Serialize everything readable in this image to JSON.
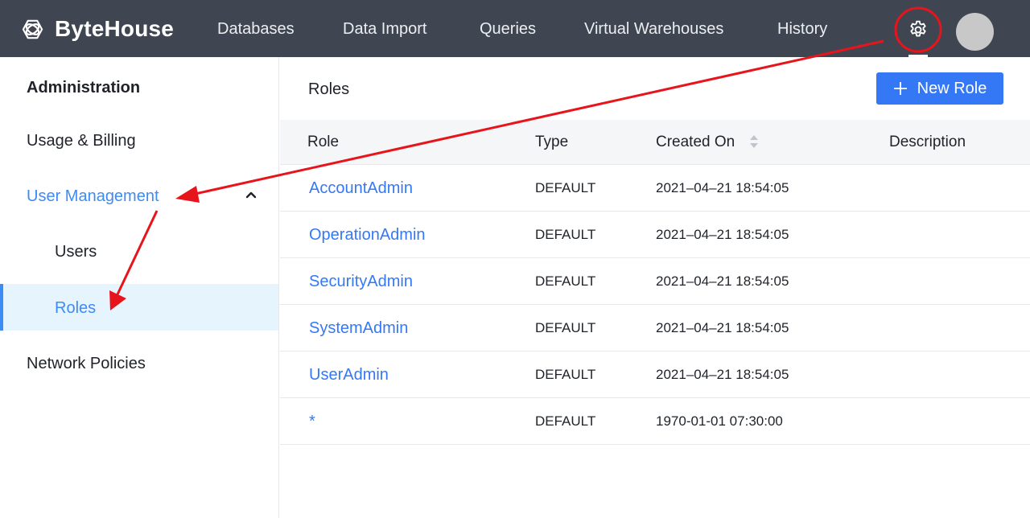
{
  "brand": {
    "name": "ByteHouse"
  },
  "nav": {
    "items": [
      {
        "label": "Databases"
      },
      {
        "label": "Data Import"
      },
      {
        "label": "Queries"
      },
      {
        "label": "Virtual Warehouses"
      },
      {
        "label": "History"
      }
    ]
  },
  "sidebar": {
    "items": [
      {
        "label": "Administration"
      },
      {
        "label": "Usage & Billing"
      },
      {
        "label": "User Management",
        "expanded": true
      },
      {
        "label": "Users"
      },
      {
        "label": "Roles",
        "selected": true
      },
      {
        "label": "Network Policies"
      }
    ]
  },
  "main": {
    "title": "Roles",
    "new_button_label": "New Role",
    "columns": [
      "Role",
      "Type",
      "Created On",
      "Description"
    ],
    "rows": [
      {
        "role": "AccountAdmin",
        "type": "DEFAULT",
        "created": "2021–04–21 18:54:05",
        "description": ""
      },
      {
        "role": "OperationAdmin",
        "type": "DEFAULT",
        "created": "2021–04–21 18:54:05",
        "description": ""
      },
      {
        "role": "SecurityAdmin",
        "type": "DEFAULT",
        "created": "2021–04–21 18:54:05",
        "description": ""
      },
      {
        "role": "SystemAdmin",
        "type": "DEFAULT",
        "created": "2021–04–21 18:54:05",
        "description": ""
      },
      {
        "role": "UserAdmin",
        "type": "DEFAULT",
        "created": "2021–04–21 18:54:05",
        "description": ""
      },
      {
        "role": "*",
        "type": "DEFAULT",
        "created": "1970-01-01 07:30:00",
        "description": ""
      }
    ]
  },
  "icons": {
    "brand": "bytehouse-logo-icon",
    "settings": "gear-icon",
    "avatar": "user-avatar",
    "collapse": "chevron-up-icon",
    "add": "plus-icon",
    "sort": "sort-icon"
  },
  "colors": {
    "topbar": "#3f4652",
    "accent": "#3478f6",
    "active_bg": "#e6f4fd",
    "annotation": "#e8141b"
  }
}
